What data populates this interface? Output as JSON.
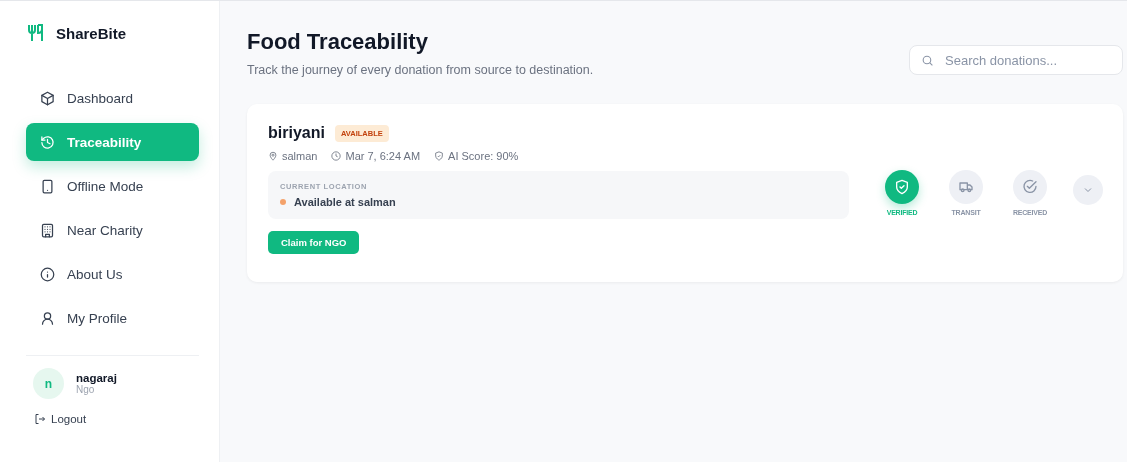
{
  "brand": {
    "name": "ShareBite"
  },
  "nav": [
    {
      "label": "Dashboard",
      "kind": "box",
      "selected": false
    },
    {
      "label": "Traceability",
      "kind": "history",
      "selected": true
    },
    {
      "label": "Offline Mode",
      "kind": "tablet",
      "selected": false
    },
    {
      "label": "Near Charity",
      "kind": "building",
      "selected": false
    },
    {
      "label": "About Us",
      "kind": "info",
      "selected": false
    },
    {
      "label": "My Profile",
      "kind": "user",
      "selected": false
    }
  ],
  "user": {
    "initial": "n",
    "name": "nagaraj",
    "role": "Ngo"
  },
  "logout": {
    "label": "Logout"
  },
  "header": {
    "title": "Food Traceability",
    "subtitle": "Track the journey of every donation from source to destination."
  },
  "search": {
    "placeholder": "Search donations..."
  },
  "donations": [
    {
      "name": "biriyani",
      "status": "AVAILABLE",
      "donor": "salman",
      "time": "Mar 7, 6:24 AM",
      "score": "AI Score: 90%",
      "location_label": "CURRENT LOCATION",
      "location": {
        "text": "Available at salman",
        "color": "#f4a26b"
      },
      "action": "Claim for NGO",
      "steps": [
        {
          "label": "VERIFIED",
          "kind": "shield",
          "done": true
        },
        {
          "label": "TRANSIT",
          "kind": "truck",
          "done": false
        },
        {
          "label": "RECEIVED",
          "kind": "check",
          "done": false
        }
      ],
      "expanded": false
    }
  ]
}
